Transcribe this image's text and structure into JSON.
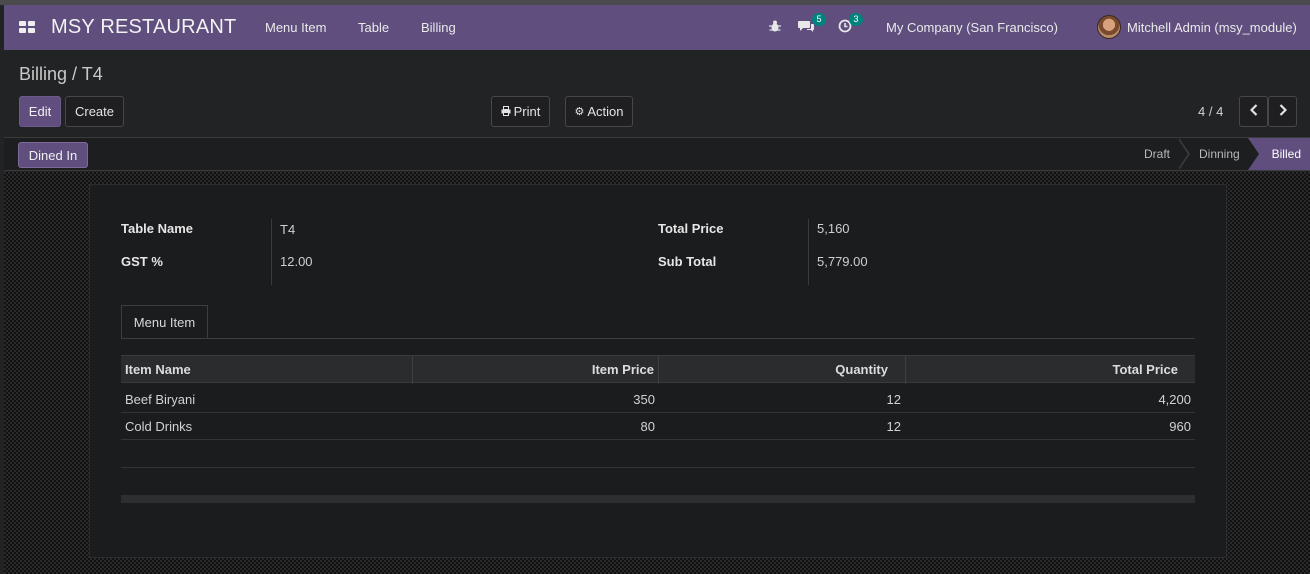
{
  "app": {
    "brand": "MSY RESTAURANT",
    "menus": [
      "Menu Item",
      "Table",
      "Billing"
    ],
    "messages_count": "5",
    "activities_count": "3",
    "company": "My Company (San Francisco)",
    "user": "Mitchell Admin (msy_module)"
  },
  "control": {
    "breadcrumb": "Billing / T4",
    "edit_label": "Edit",
    "create_label": "Create",
    "print_label": "Print",
    "action_label": "Action",
    "pager": "4 / 4"
  },
  "statusbar": {
    "button_label": "Dined In",
    "stages": [
      "Draft",
      "Dinning",
      "Billed"
    ],
    "active_stage": "Billed"
  },
  "form": {
    "table_name_label": "Table Name",
    "table_name": "T4",
    "gst_label": "GST %",
    "gst": "12.00",
    "total_price_label": "Total Price",
    "total_price": "5,160",
    "sub_total_label": "Sub Total",
    "sub_total": "5,779.00"
  },
  "notebook": {
    "tab_label": "Menu Item",
    "columns": [
      "Item Name",
      "Item Price",
      "Quantity",
      "Total Price"
    ],
    "rows": [
      {
        "name": "Beef Biryani",
        "price": "350",
        "qty": "12",
        "total": "4,200"
      },
      {
        "name": "Cold Drinks",
        "price": "80",
        "qty": "12",
        "total": "960"
      }
    ]
  },
  "colors": {
    "accent": "#5f4e7e",
    "badge": "#00827d"
  }
}
